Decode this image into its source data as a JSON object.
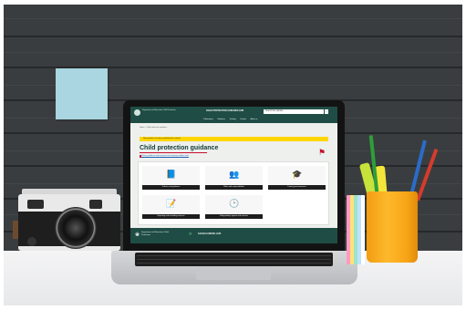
{
  "website": {
    "org_name": "Department of Education Child Protection",
    "header_center": "CHILD PROTECTION GUIDANCE HUB",
    "search_placeholder": "Search the website",
    "search_button": "⌕",
    "nav_items": [
      "Publications",
      "Guidance",
      "Training",
      "Contact",
      "About us"
    ],
    "breadcrumb": "Home > Child protection guidance",
    "alert_text": "New guidance has been published for schools",
    "page_title": "Child protection guidance",
    "subtitle_link": "Policy, guidance and resources for keeping children safe",
    "badge_icon": "⚑",
    "cards": [
      {
        "label": "Policies and guidance",
        "icon": "📘"
      },
      {
        "label": "Roles and responsibilities",
        "icon": "👥"
      },
      {
        "label": "Training and resources",
        "icon": "🎓"
      },
      {
        "label": "Reporting and recording concerns",
        "icon": "📝"
      },
      {
        "label": "Safeguarding support and contacts",
        "icon": "🕑"
      }
    ],
    "footer_left": "Department of Education Child Protection",
    "footer_right": "SAFEGUARDING HUB"
  },
  "colors": {
    "header_bg": "#1f4d45",
    "alert_bg": "#ffd600",
    "accent_red": "#c8102e",
    "card_label_bg": "#1d1d1d"
  }
}
